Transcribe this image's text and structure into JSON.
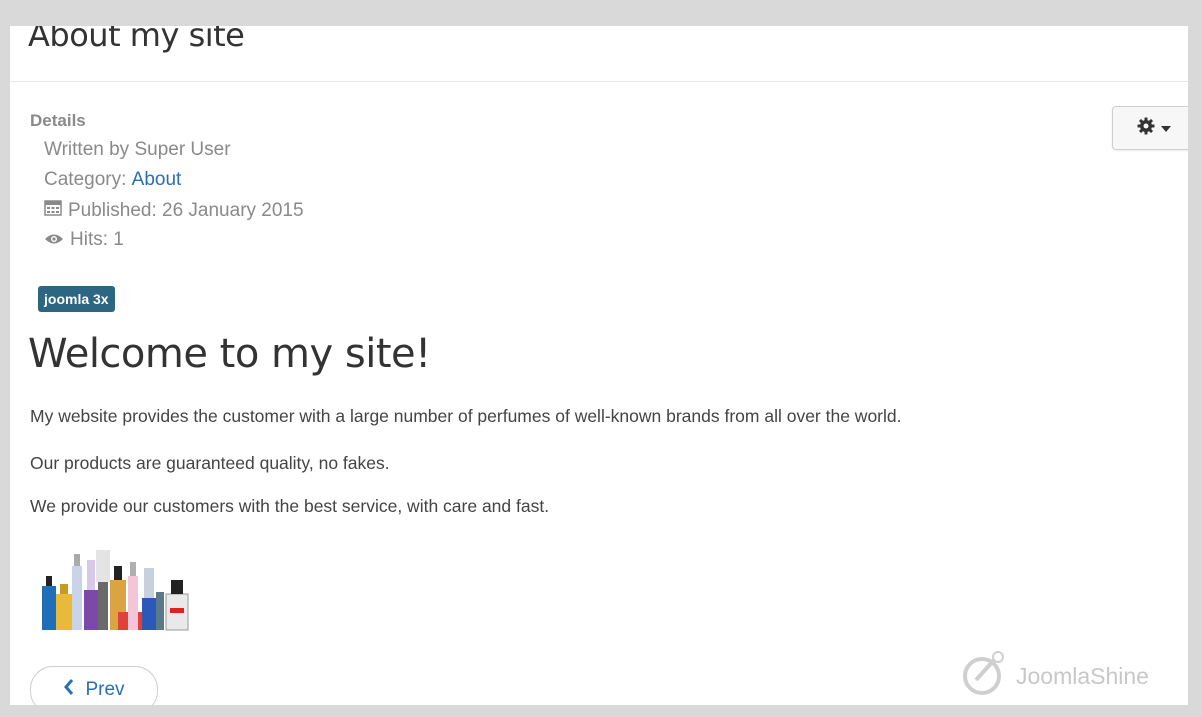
{
  "article": {
    "title": "About my site",
    "details_label": "Details",
    "written_by": "Written by Super User",
    "category_prefix": "Category: ",
    "category_link": "About",
    "published": "Published: 26 January 2015",
    "hits": "Hits: 1",
    "tag": "joomla 3x",
    "heading": "Welcome to my site!",
    "paragraphs": [
      "My website provides the customer with a large number of perfumes of well-known brands from all over the world.",
      "Our products are guaranteed quality, no fakes.",
      "We provide our customers with the best service, with care and fast."
    ]
  },
  "toolbar": {
    "gear_icon": "gear-icon",
    "caret_icon": "caret-down-icon"
  },
  "pagination": {
    "prev_label": "Prev",
    "prev_icon": "chevron-left-icon"
  },
  "watermark": {
    "brand": "JoomlaShine"
  },
  "colors": {
    "link": "#2a6fb5",
    "tag_bg": "#2d6682",
    "meta_text": "#8a8a8a"
  }
}
